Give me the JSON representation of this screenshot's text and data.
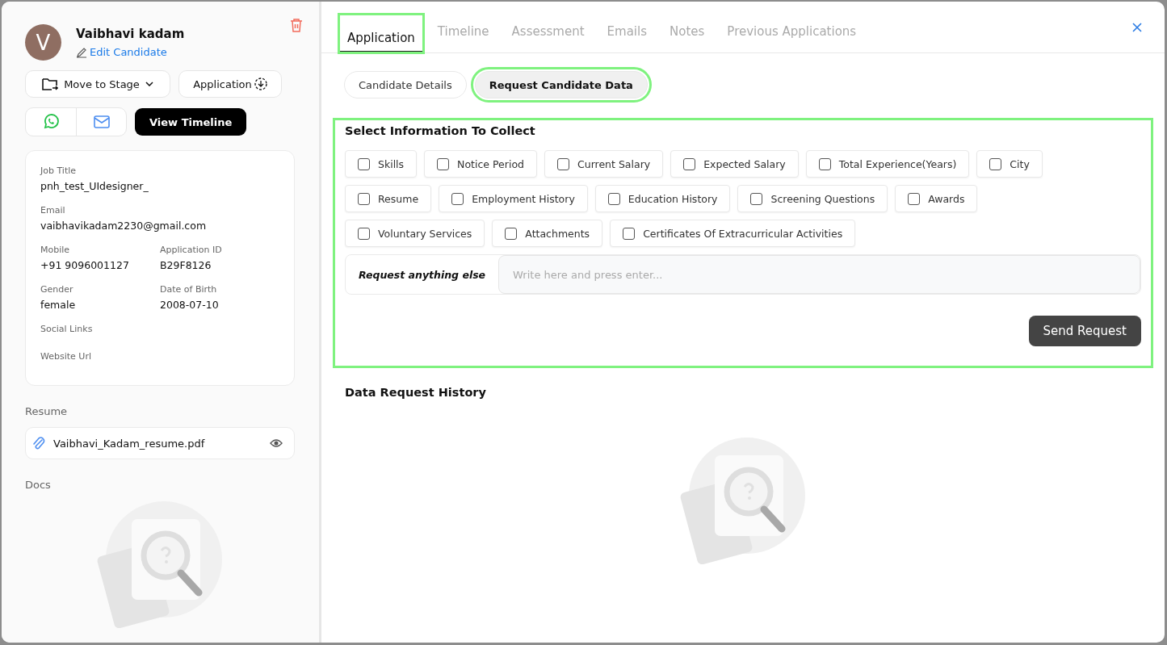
{
  "candidate": {
    "initial": "V",
    "name": "Vaibhavi kadam",
    "edit_link": "Edit Candidate"
  },
  "actions": {
    "stage_button": "Move to Stage",
    "application_button": "Application",
    "timeline_button": "View Timeline"
  },
  "details": [
    [
      {
        "label": "Job Title",
        "value": "pnh_test_UIdesigner_"
      }
    ],
    [
      {
        "label": "Email",
        "value": "vaibhavikadam2230@gmail.com"
      }
    ],
    [
      {
        "label": "Mobile",
        "value": "+91 9096001127"
      },
      {
        "label": "Application ID",
        "value": "B29F8126"
      }
    ],
    [
      {
        "label": "Gender",
        "value": "female"
      },
      {
        "label": "Date of Birth",
        "value": "2008-07-10"
      }
    ],
    [
      {
        "label": "Social Links"
      }
    ],
    [
      {
        "label": "Website Url"
      }
    ]
  ],
  "resume": {
    "heading": "Resume",
    "file": "Vaibhavi_Kadam_resume.pdf"
  },
  "docs": {
    "heading": "Docs"
  },
  "tabs": [
    {
      "label": "Application",
      "selected": true,
      "highlighted": true
    },
    {
      "label": "Timeline",
      "selected": false,
      "highlighted": false
    },
    {
      "label": "Assessment",
      "selected": false,
      "highlighted": false
    },
    {
      "label": "Emails",
      "selected": false,
      "highlighted": false
    },
    {
      "label": "Notes",
      "selected": false,
      "highlighted": false
    },
    {
      "label": "Previous Applications",
      "selected": false,
      "highlighted": false
    }
  ],
  "subtabs": [
    {
      "label": "Candidate Details",
      "selected": false,
      "highlighted": false
    },
    {
      "label": "Request Candidate Data",
      "selected": true,
      "highlighted": true
    }
  ],
  "collect": {
    "title": "Select Information To Collect",
    "highlighted": true,
    "options": [
      [
        {
          "label": "Skills",
          "checked": false
        },
        {
          "label": "Notice Period",
          "checked": false
        },
        {
          "label": "Current Salary",
          "checked": false
        },
        {
          "label": "Expected Salary",
          "checked": false
        },
        {
          "label": "Total Experience(Years)",
          "checked": false
        },
        {
          "label": "City",
          "checked": false
        }
      ],
      [
        {
          "label": "Resume",
          "checked": false
        },
        {
          "label": "Employment History",
          "checked": false
        },
        {
          "label": "Education History",
          "checked": false
        },
        {
          "label": "Screening Questions",
          "checked": false
        },
        {
          "label": "Awards",
          "checked": false
        }
      ],
      [
        {
          "label": "Voluntary Services",
          "checked": false
        },
        {
          "label": "Attachments",
          "checked": false
        },
        {
          "label": "Certificates Of Extracurricular Activities",
          "checked": false
        }
      ]
    ],
    "other_label": "Request anything else",
    "other_placeholder": "Write here and press enter...",
    "send_button": "Send Request"
  },
  "history": {
    "title": "Data Request History"
  }
}
